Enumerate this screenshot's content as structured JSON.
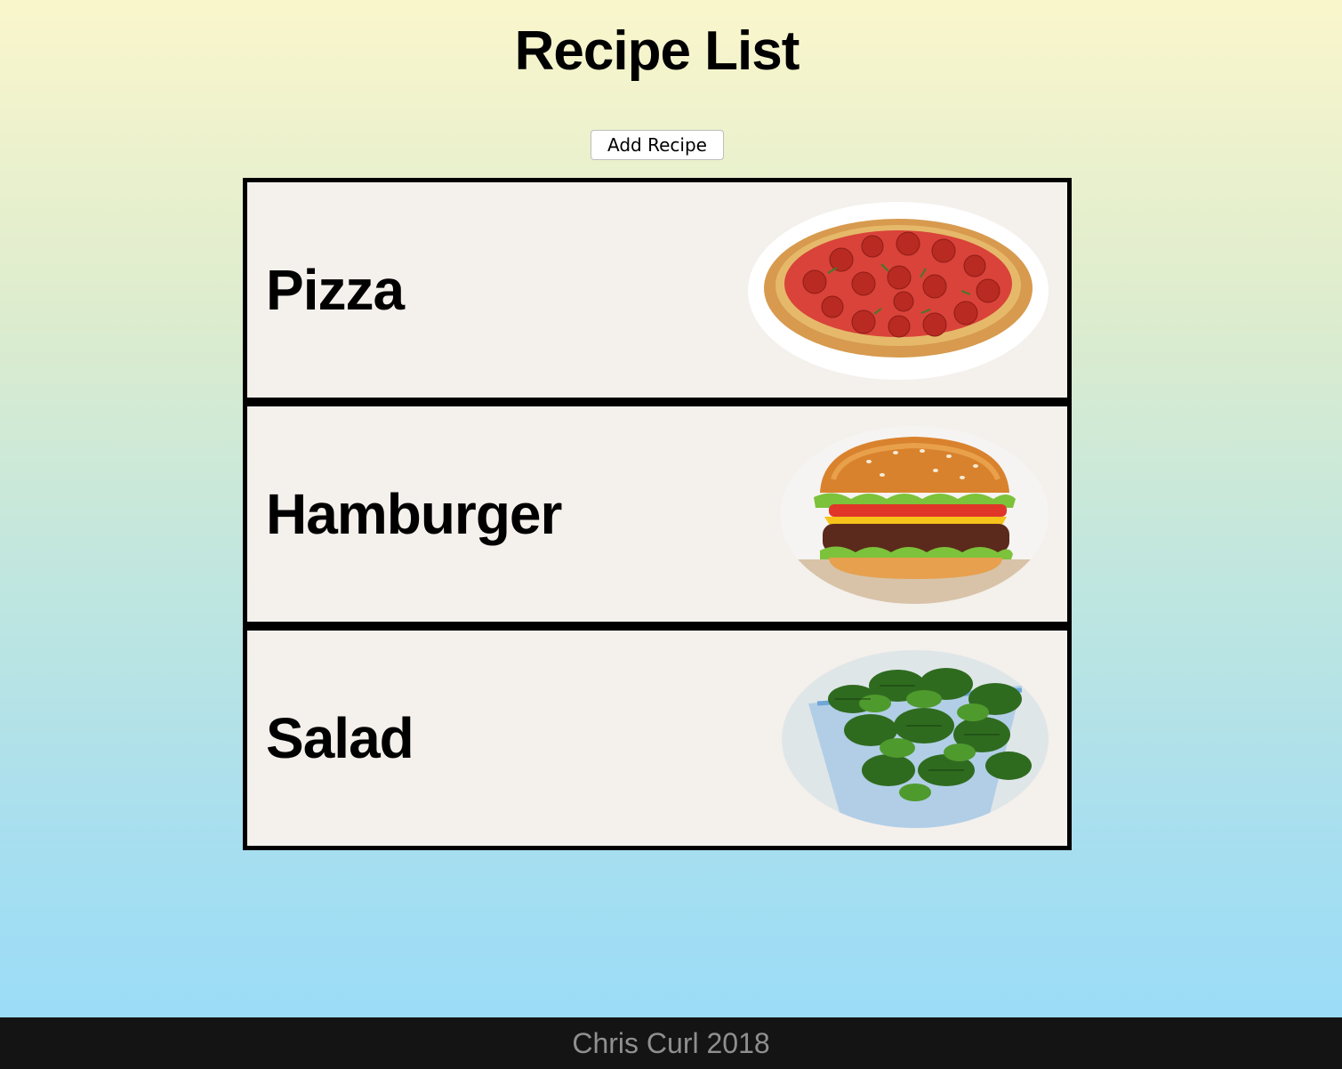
{
  "header": {
    "title": "Recipe List"
  },
  "toolbar": {
    "add_label": "Add Recipe"
  },
  "recipes": [
    {
      "name": "Pizza",
      "icon": "pizza-image"
    },
    {
      "name": "Hamburger",
      "icon": "hamburger-image"
    },
    {
      "name": "Salad",
      "icon": "salad-image"
    }
  ],
  "footer": {
    "text": "Chris Curl 2018"
  },
  "colors": {
    "background_top": "#faf6cc",
    "background_bottom": "#98dcf9",
    "card_background": "#f4f0ec",
    "card_border": "#000000",
    "footer_background": "#141414",
    "footer_text": "#8f8f8f"
  }
}
